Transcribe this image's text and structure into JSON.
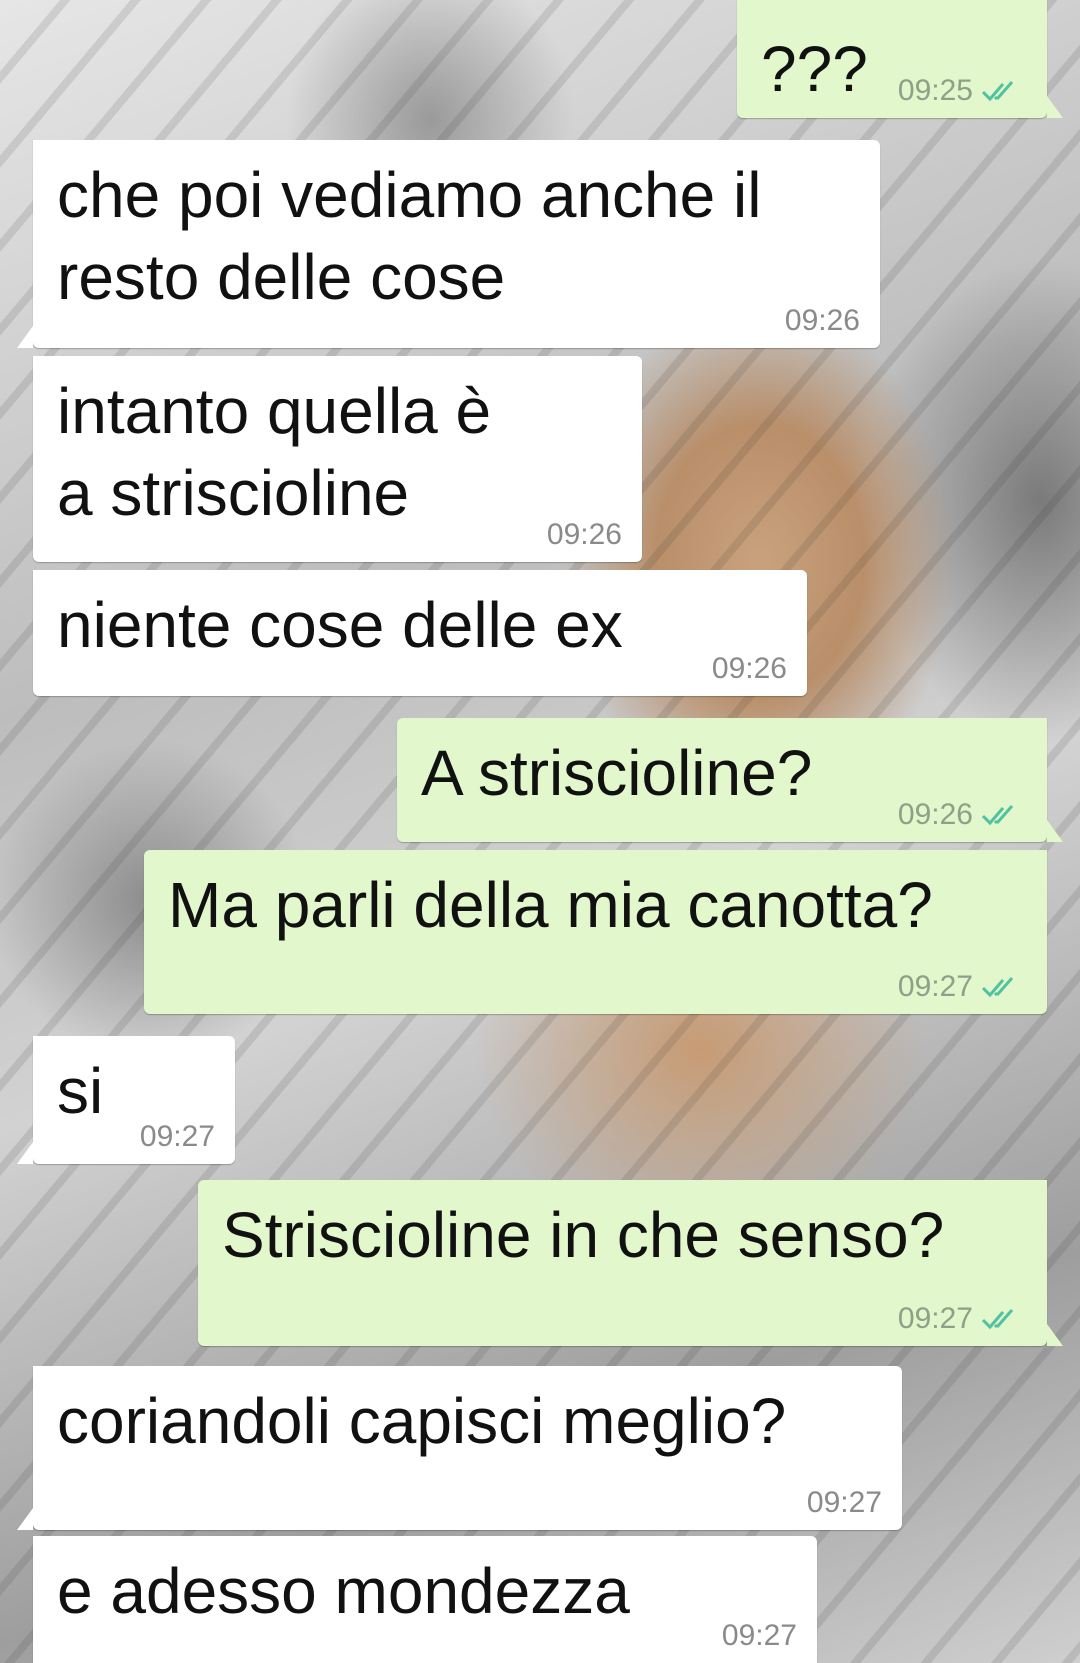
{
  "messages": [
    {
      "dir": "out",
      "text": "???",
      "time": "09:25",
      "read": true
    },
    {
      "dir": "in",
      "text": "che poi vediamo anche il resto delle cose",
      "time": "09:26"
    },
    {
      "dir": "in",
      "text": "intanto quella è a striscioline",
      "time": "09:26"
    },
    {
      "dir": "in",
      "text": "niente cose delle ex",
      "time": "09:26"
    },
    {
      "dir": "out",
      "text": "A striscioline?",
      "time": "09:26",
      "read": true
    },
    {
      "dir": "out",
      "text": "Ma parli della mia canotta?",
      "time": "09:27",
      "read": true
    },
    {
      "dir": "in",
      "text": "si",
      "time": "09:27"
    },
    {
      "dir": "out",
      "text": "Striscioline in che senso?",
      "time": "09:27",
      "read": true
    },
    {
      "dir": "in",
      "text": "coriandoli capisci meglio?",
      "time": "09:27"
    },
    {
      "dir": "in",
      "text": "e adesso mondezza",
      "time": "09:27"
    }
  ],
  "colors": {
    "incoming_bubble": "#ffffff",
    "outgoing_bubble": "#e2f7cb",
    "read_ticks": "#4fc3a1",
    "timestamp": "#8a8a8a"
  },
  "icons": {
    "read_receipt": "double-check-icon",
    "background": "chat-wallpaper"
  }
}
